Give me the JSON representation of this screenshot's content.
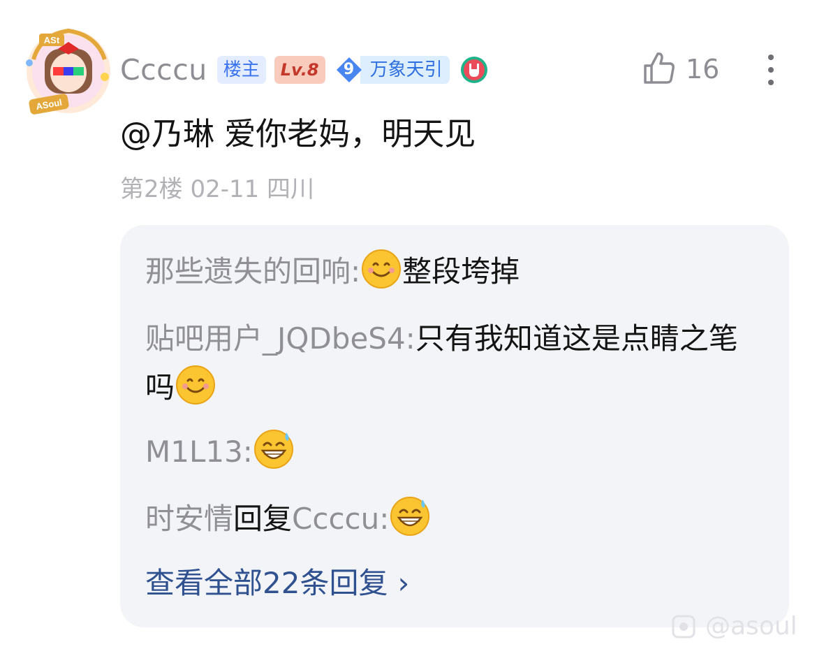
{
  "post": {
    "username": "Ccccu",
    "badge_owner": "楼主",
    "badge_level": "Lv.8",
    "fan_level": "9",
    "fan_group": "万象天引",
    "like_count": "16",
    "content": "@乃琳 爱你老妈，明天见",
    "meta": "第2楼 02-11 四川"
  },
  "avatar": {
    "top_text": "ASt",
    "bottom_text": "ASoul"
  },
  "replies": [
    {
      "name": "那些遗失的回响:",
      "emoji": "smile-emoji",
      "text": "整段垮掉"
    },
    {
      "name": "贴吧用户_JQDbeS4:",
      "text": "只有我知道这是点睛之笔吗",
      "emoji": "smile-emoji"
    },
    {
      "name": "M1L13:",
      "emoji": "grin-sweat-emoji"
    },
    {
      "name": "时安情",
      "reply_word": "回复",
      "target": "Ccccu:",
      "emoji": "grin-sweat-emoji"
    }
  ],
  "view_all": "查看全部22条回复",
  "view_all_arrow": "›",
  "watermark": "@asoul",
  "colors": {
    "accent_link": "#2f5190",
    "owner_badge_bg": "#e4edff",
    "level_badge_bg": "#f9cbbc",
    "reply_box_bg": "#f3f4f7"
  }
}
